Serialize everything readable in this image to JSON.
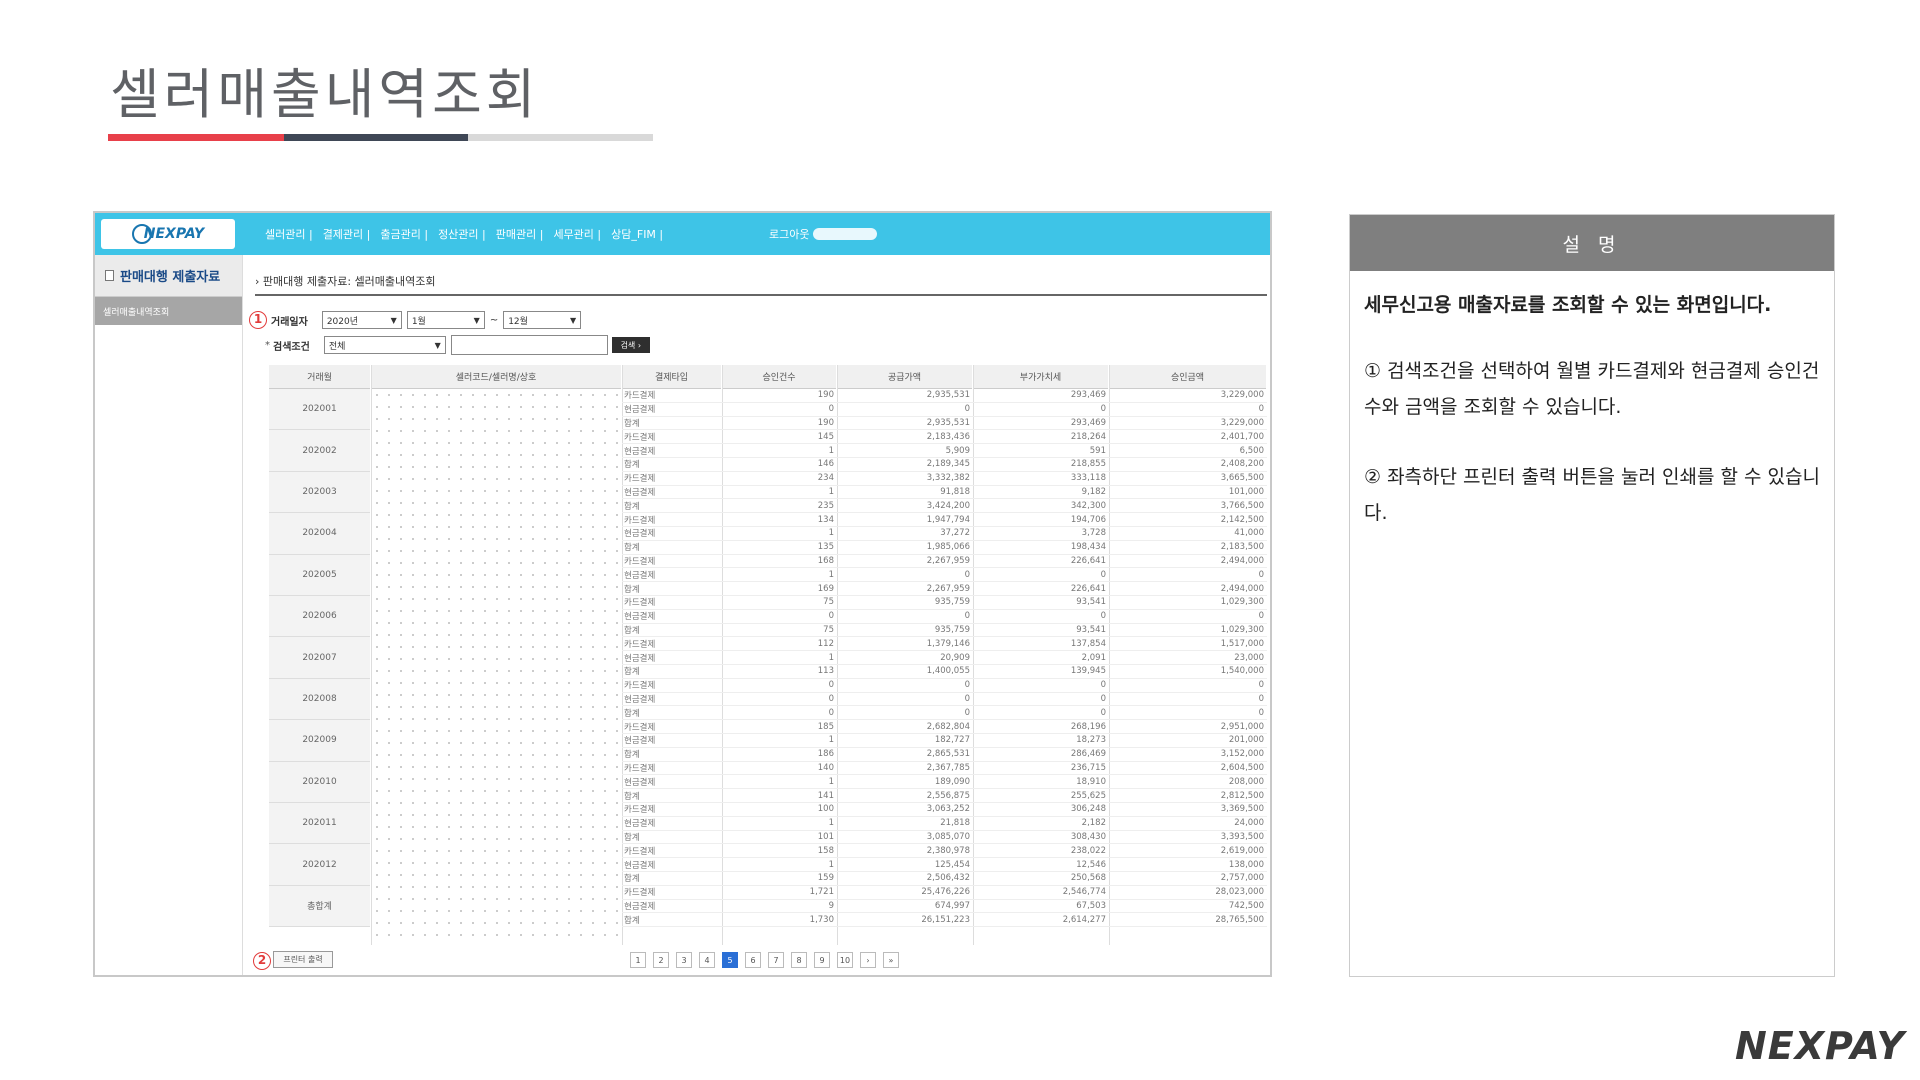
{
  "slide": {
    "title": "셀러매출내역조회",
    "brand": "NEXPAY"
  },
  "app": {
    "logo": "NEXPAY",
    "menu": [
      "셀러관리",
      "결제관리",
      "출금관리",
      "정산관리",
      "판매관리",
      "세무관리",
      "상담_FIM"
    ],
    "logout": "로그아웃"
  },
  "sidebar": {
    "heading": "판매대행 제출자료",
    "items": [
      "셀러매출내역조회"
    ]
  },
  "breadcrumb": "판매대행 제출자료: 셀러매출내역조회",
  "filters": {
    "marker1": "1",
    "period_label": "거래일자",
    "year": "2020년",
    "month_from": "1월",
    "tilde": "~",
    "month_to": "12월",
    "condition_label": "검색조건",
    "condition": "전체",
    "search_button": "검색"
  },
  "table": {
    "headers": [
      "거래월",
      "셀러코드/셀러명/상호",
      "결제타입",
      "승인건수",
      "공급가액",
      "부가가치세",
      "승인금액"
    ],
    "groups": [
      {
        "month": "202001",
        "rows": [
          [
            "카드결제",
            "190",
            "2,935,531",
            "293,469",
            "3,229,000"
          ],
          [
            "현금결제",
            "0",
            "0",
            "0",
            "0"
          ],
          [
            "합계",
            "190",
            "2,935,531",
            "293,469",
            "3,229,000"
          ]
        ]
      },
      {
        "month": "202002",
        "rows": [
          [
            "카드결제",
            "145",
            "2,183,436",
            "218,264",
            "2,401,700"
          ],
          [
            "현금결제",
            "1",
            "5,909",
            "591",
            "6,500"
          ],
          [
            "합계",
            "146",
            "2,189,345",
            "218,855",
            "2,408,200"
          ]
        ]
      },
      {
        "month": "202003",
        "rows": [
          [
            "카드결제",
            "234",
            "3,332,382",
            "333,118",
            "3,665,500"
          ],
          [
            "현금결제",
            "1",
            "91,818",
            "9,182",
            "101,000"
          ],
          [
            "합계",
            "235",
            "3,424,200",
            "342,300",
            "3,766,500"
          ]
        ]
      },
      {
        "month": "202004",
        "rows": [
          [
            "카드결제",
            "134",
            "1,947,794",
            "194,706",
            "2,142,500"
          ],
          [
            "현금결제",
            "1",
            "37,272",
            "3,728",
            "41,000"
          ],
          [
            "합계",
            "135",
            "1,985,066",
            "198,434",
            "2,183,500"
          ]
        ]
      },
      {
        "month": "202005",
        "rows": [
          [
            "카드결제",
            "168",
            "2,267,959",
            "226,641",
            "2,494,000"
          ],
          [
            "현금결제",
            "1",
            "0",
            "0",
            "0"
          ],
          [
            "합계",
            "169",
            "2,267,959",
            "226,641",
            "2,494,000"
          ]
        ]
      },
      {
        "month": "202006",
        "rows": [
          [
            "카드결제",
            "75",
            "935,759",
            "93,541",
            "1,029,300"
          ],
          [
            "현금결제",
            "0",
            "0",
            "0",
            "0"
          ],
          [
            "합계",
            "75",
            "935,759",
            "93,541",
            "1,029,300"
          ]
        ]
      },
      {
        "month": "202007",
        "rows": [
          [
            "카드결제",
            "112",
            "1,379,146",
            "137,854",
            "1,517,000"
          ],
          [
            "현금결제",
            "1",
            "20,909",
            "2,091",
            "23,000"
          ],
          [
            "합계",
            "113",
            "1,400,055",
            "139,945",
            "1,540,000"
          ]
        ]
      },
      {
        "month": "202008",
        "rows": [
          [
            "카드결제",
            "0",
            "0",
            "0",
            "0"
          ],
          [
            "현금결제",
            "0",
            "0",
            "0",
            "0"
          ],
          [
            "합계",
            "0",
            "0",
            "0",
            "0"
          ]
        ]
      },
      {
        "month": "202009",
        "rows": [
          [
            "카드결제",
            "185",
            "2,682,804",
            "268,196",
            "2,951,000"
          ],
          [
            "현금결제",
            "1",
            "182,727",
            "18,273",
            "201,000"
          ],
          [
            "합계",
            "186",
            "2,865,531",
            "286,469",
            "3,152,000"
          ]
        ]
      },
      {
        "month": "202010",
        "rows": [
          [
            "카드결제",
            "140",
            "2,367,785",
            "236,715",
            "2,604,500"
          ],
          [
            "현금결제",
            "1",
            "189,090",
            "18,910",
            "208,000"
          ],
          [
            "합계",
            "141",
            "2,556,875",
            "255,625",
            "2,812,500"
          ]
        ]
      },
      {
        "month": "202011",
        "rows": [
          [
            "카드결제",
            "100",
            "3,063,252",
            "306,248",
            "3,369,500"
          ],
          [
            "현금결제",
            "1",
            "21,818",
            "2,182",
            "24,000"
          ],
          [
            "합계",
            "101",
            "3,085,070",
            "308,430",
            "3,393,500"
          ]
        ]
      },
      {
        "month": "202012",
        "rows": [
          [
            "카드결제",
            "158",
            "2,380,978",
            "238,022",
            "2,619,000"
          ],
          [
            "현금결제",
            "1",
            "125,454",
            "12,546",
            "138,000"
          ],
          [
            "합계",
            "159",
            "2,506,432",
            "250,568",
            "2,757,000"
          ]
        ]
      },
      {
        "month": "총합계",
        "rows": [
          [
            "카드결제",
            "1,721",
            "25,476,226",
            "2,546,774",
            "28,023,000"
          ],
          [
            "현금결제",
            "9",
            "674,997",
            "67,503",
            "742,500"
          ],
          [
            "합계",
            "1,730",
            "26,151,223",
            "2,614,277",
            "28,765,500"
          ]
        ]
      }
    ]
  },
  "footer": {
    "marker2": "2",
    "print_button": "프린터 출력",
    "pages": [
      "1",
      "2",
      "3",
      "4",
      "5",
      "6",
      "7",
      "8",
      "9",
      "10",
      "›",
      "»"
    ],
    "active_page": "5"
  },
  "description": {
    "heading": "설 명",
    "lead": "세무신고용 매출자료를 조회할 수 있는 화면입니다.",
    "point1": "① 검색조건을 선택하여 월별 카드결제와 현금결제 승인건수와 금액을 조회할 수 있습니다.",
    "point2": "② 좌측하단 프린터 출력 버튼을 눌러 인쇄를 할 수 있습니다."
  },
  "colors": {
    "nav": "#3ec4e7",
    "accent_red": "#e8404a",
    "accent_dark": "#3f4756",
    "desc_head": "#7f7f7f"
  }
}
